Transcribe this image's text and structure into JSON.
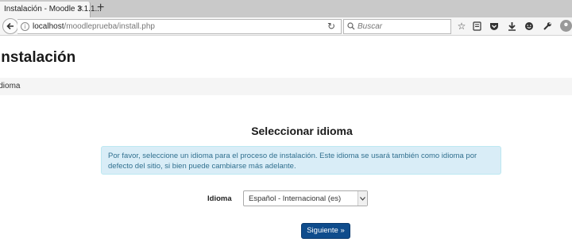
{
  "browser": {
    "tab_title": "Instalación - Moodle 3.1.1...",
    "tab_close": "×",
    "new_tab": "+",
    "url_host": "localhost",
    "url_path": "/moodleprueba/install.php",
    "search_placeholder": "Buscar",
    "icons": [
      "back-arrow-icon",
      "info-icon",
      "reload-icon",
      "search-icon",
      "bookmark-star-icon",
      "reading-list-icon",
      "pocket-icon",
      "download-icon",
      "smiley-icon",
      "wrench-icon",
      "account-avatar-icon"
    ]
  },
  "page": {
    "title": "Instalación",
    "breadcrumb": "idioma"
  },
  "main": {
    "heading": "Seleccionar idioma",
    "alert_text": "Por favor, seleccione un idioma para el proceso de instalación. Este idioma se usará también como idioma por defecto del sitio, si bien puede cambiarse más adelante.",
    "language_label": "Idioma",
    "language_selected": "Español - Internacional (es)",
    "next_button": "Siguiente »"
  },
  "colors": {
    "alert_bg": "#d9edf7",
    "alert_text": "#31708f",
    "primary_button": "#0f4c8c"
  }
}
